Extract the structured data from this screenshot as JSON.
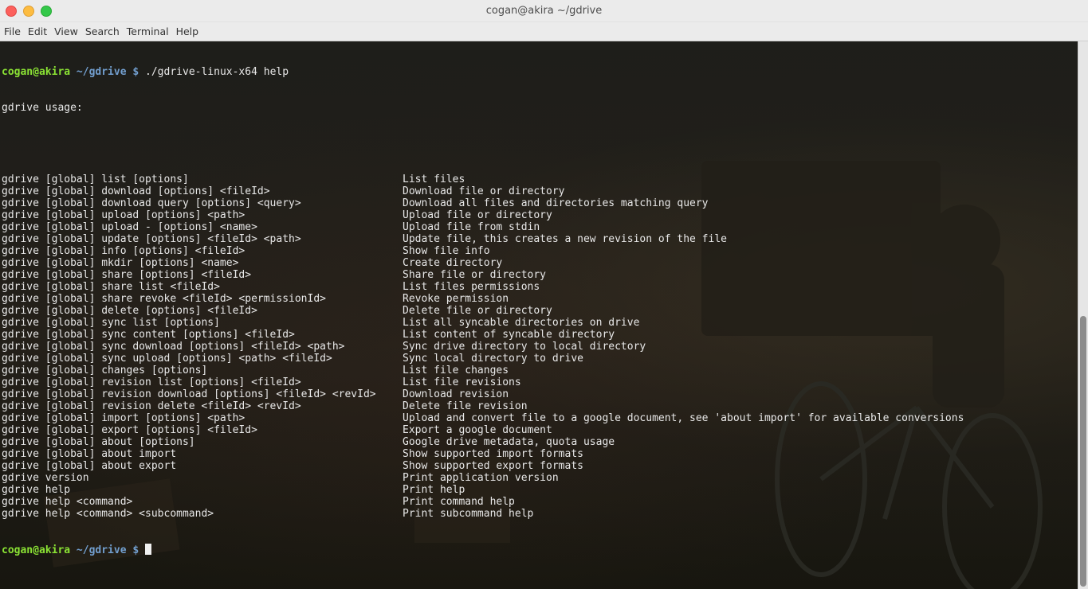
{
  "window": {
    "title": "cogan@akira ~/gdrive"
  },
  "menu": [
    "File",
    "Edit",
    "View",
    "Search",
    "Terminal",
    "Help"
  ],
  "prompt": {
    "user_host": "cogan@akira",
    "path": "~/gdrive",
    "symbol": "$",
    "command": "./gdrive-linux-x64 help"
  },
  "usage_header": "gdrive usage:",
  "commands": [
    {
      "cmd": "gdrive [global] list [options]",
      "desc": "List files"
    },
    {
      "cmd": "gdrive [global] download [options] <fileId>",
      "desc": "Download file or directory"
    },
    {
      "cmd": "gdrive [global] download query [options] <query>",
      "desc": "Download all files and directories matching query"
    },
    {
      "cmd": "gdrive [global] upload [options] <path>",
      "desc": "Upload file or directory"
    },
    {
      "cmd": "gdrive [global] upload - [options] <name>",
      "desc": "Upload file from stdin"
    },
    {
      "cmd": "gdrive [global] update [options] <fileId> <path>",
      "desc": "Update file, this creates a new revision of the file"
    },
    {
      "cmd": "gdrive [global] info [options] <fileId>",
      "desc": "Show file info"
    },
    {
      "cmd": "gdrive [global] mkdir [options] <name>",
      "desc": "Create directory"
    },
    {
      "cmd": "gdrive [global] share [options] <fileId>",
      "desc": "Share file or directory"
    },
    {
      "cmd": "gdrive [global] share list <fileId>",
      "desc": "List files permissions"
    },
    {
      "cmd": "gdrive [global] share revoke <fileId> <permissionId>",
      "desc": "Revoke permission"
    },
    {
      "cmd": "gdrive [global] delete [options] <fileId>",
      "desc": "Delete file or directory"
    },
    {
      "cmd": "gdrive [global] sync list [options]",
      "desc": "List all syncable directories on drive"
    },
    {
      "cmd": "gdrive [global] sync content [options] <fileId>",
      "desc": "List content of syncable directory"
    },
    {
      "cmd": "gdrive [global] sync download [options] <fileId> <path>",
      "desc": "Sync drive directory to local directory"
    },
    {
      "cmd": "gdrive [global] sync upload [options] <path> <fileId>",
      "desc": "Sync local directory to drive"
    },
    {
      "cmd": "gdrive [global] changes [options]",
      "desc": "List file changes"
    },
    {
      "cmd": "gdrive [global] revision list [options] <fileId>",
      "desc": "List file revisions"
    },
    {
      "cmd": "gdrive [global] revision download [options] <fileId> <revId>",
      "desc": "Download revision"
    },
    {
      "cmd": "gdrive [global] revision delete <fileId> <revId>",
      "desc": "Delete file revision"
    },
    {
      "cmd": "gdrive [global] import [options] <path>",
      "desc": "Upload and convert file to a google document, see 'about import' for available conversions"
    },
    {
      "cmd": "gdrive [global] export [options] <fileId>",
      "desc": "Export a google document"
    },
    {
      "cmd": "gdrive [global] about [options]",
      "desc": "Google drive metadata, quota usage"
    },
    {
      "cmd": "gdrive [global] about import",
      "desc": "Show supported import formats"
    },
    {
      "cmd": "gdrive [global] about export",
      "desc": "Show supported export formats"
    },
    {
      "cmd": "gdrive version",
      "desc": "Print application version"
    },
    {
      "cmd": "gdrive help",
      "desc": "Print help"
    },
    {
      "cmd": "gdrive help <command>",
      "desc": "Print command help"
    },
    {
      "cmd": "gdrive help <command> <subcommand>",
      "desc": "Print subcommand help"
    }
  ],
  "colors": {
    "prompt_user": "#8ae234",
    "prompt_path": "#729fcf",
    "text": "#e8e8e8"
  }
}
